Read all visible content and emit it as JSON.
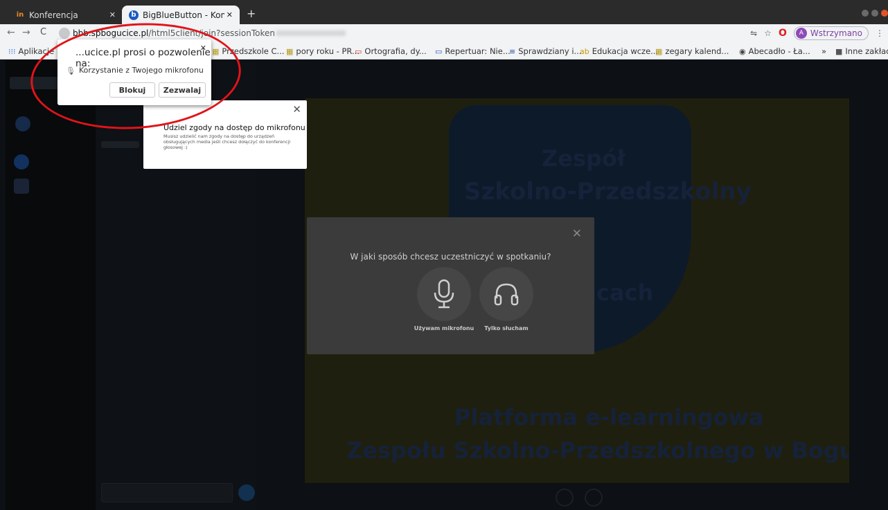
{
  "browser": {
    "tabs": [
      {
        "label": "Konferencja",
        "favicon": "in"
      },
      {
        "label": "BigBlueButton - Konferen",
        "favicon": "b"
      }
    ],
    "url_host": "bbb.spbogucice.pl",
    "url_path": "/html5client/join?sessionToken",
    "profile_label": "Wstrzymano",
    "profile_initial": "A",
    "bookmarks": [
      {
        "label": "Aplikacje",
        "icon": "apps-icon"
      },
      {
        "label": "Przedszkole C...",
        "icon": "folder-image-icon"
      },
      {
        "label": "pory roku - PR...",
        "icon": "folder-image-icon"
      },
      {
        "label": "Ortografia, dy...",
        "icon": "presentation-icon"
      },
      {
        "label": "Repertuar: Nie...",
        "icon": "ticket-icon"
      },
      {
        "label": "Sprawdziany i...",
        "icon": "quiz-icon"
      },
      {
        "label": "Edukacja wcze...",
        "icon": "abc-icon"
      },
      {
        "label": "zegary kalend...",
        "icon": "folder-image-icon"
      },
      {
        "label": "Abecadło - Ła...",
        "icon": "globe-icon"
      }
    ],
    "other_bookmarks": "Inne zakładk"
  },
  "permission": {
    "title": "...ucice.pl prosi o pozwolenie na:",
    "item": "Korzystanie z Twojego mikrofonu",
    "block_label": "Blokuj",
    "allow_label": "Zezwalaj"
  },
  "tooltip": {
    "title": "Udziel zgody na dostęp do mikrofonu",
    "body": "Musisz udzielić nam zgody na dostęp do urządzeń obsługujących media jeśli chcesz dołączyć do konferencji głosowej :)"
  },
  "audio_modal": {
    "question": "W jaki sposób chcesz uczestniczyć w spotkaniu?",
    "mic_label": "Używam mikrofonu",
    "listen_label": "Tylko słucham"
  },
  "slide": {
    "line1": "Zespół",
    "line2": "Szkolno-Przedszkolny",
    "line3": "icach",
    "line4": "Platforma e-learningowa",
    "line5": "Zespołu Szkolno-Przedszkolnego w Bogucicach"
  },
  "colors": {
    "accent_red": "#e0141a",
    "profile_purple": "#8e4bb8",
    "modal_bg": "#3b3b3b"
  }
}
